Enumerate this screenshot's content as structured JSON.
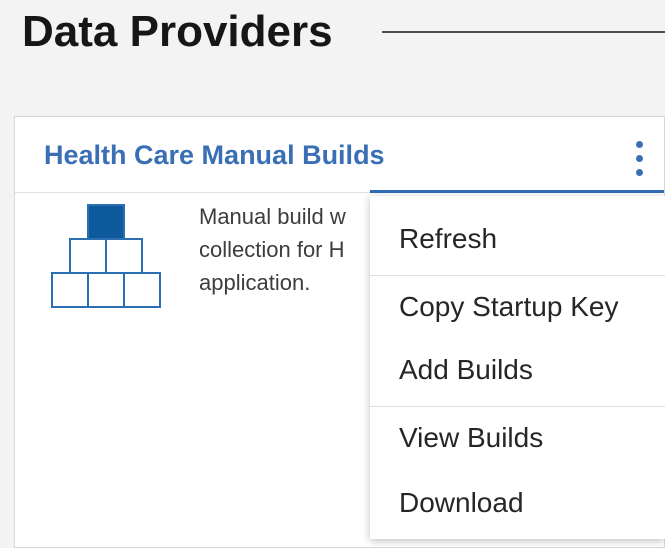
{
  "page": {
    "title": "Data Providers"
  },
  "card": {
    "title": "Health Care Manual Builds",
    "description": "Manual build w\ncollection for H\napplication.",
    "overflow_icon": "overflow-menu-vertical-icon",
    "illustration_icon": "pyramid-blocks-icon"
  },
  "menu": {
    "items": [
      {
        "label": "Refresh"
      },
      {
        "label": "Copy Startup Key"
      },
      {
        "label": "Add Builds"
      },
      {
        "label": "View Builds"
      },
      {
        "label": "Download"
      }
    ]
  },
  "colors": {
    "accent": "#3a6fb5",
    "active_line": "#2f6db5",
    "icon_fill": "#0f5a9c",
    "icon_stroke": "#2d6fb3",
    "background": "#f3f3f3"
  }
}
